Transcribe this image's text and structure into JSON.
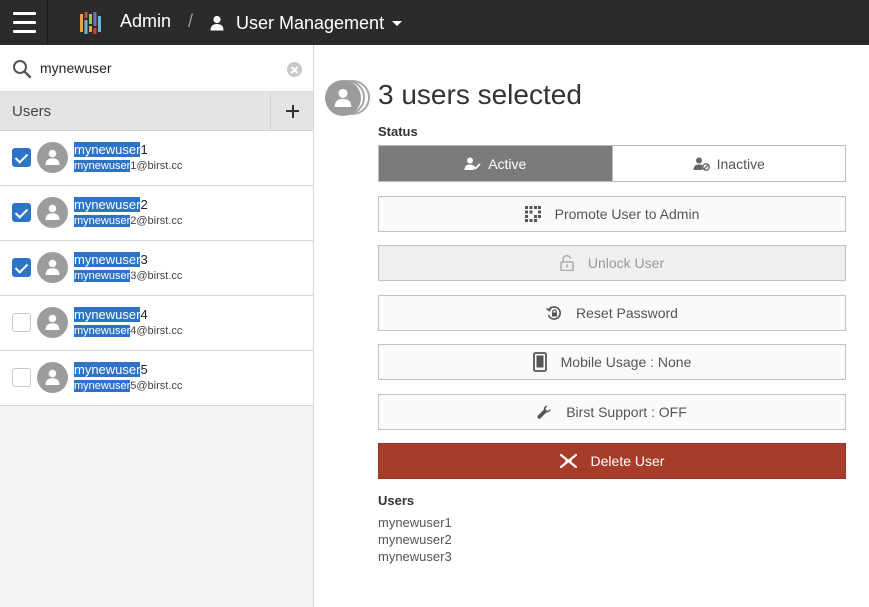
{
  "header": {
    "app_title": "Admin",
    "separator": "/",
    "breadcrumb_label": "User Management"
  },
  "search": {
    "value": "mynewuser",
    "placeholder": ""
  },
  "users_panel": {
    "header_label": "Users",
    "users": [
      {
        "name_highlight": "mynewuser",
        "name_rest": "1",
        "email_highlight": "mynewuser",
        "email_rest": "1@birst.cc",
        "checked": true
      },
      {
        "name_highlight": "mynewuser",
        "name_rest": "2",
        "email_highlight": "mynewuser",
        "email_rest": "2@birst.cc",
        "checked": true
      },
      {
        "name_highlight": "mynewuser",
        "name_rest": "3",
        "email_highlight": "mynewuser",
        "email_rest": "3@birst.cc",
        "checked": true
      },
      {
        "name_highlight": "mynewuser",
        "name_rest": "4",
        "email_highlight": "mynewuser",
        "email_rest": "4@birst.cc",
        "checked": false
      },
      {
        "name_highlight": "mynewuser",
        "name_rest": "5",
        "email_highlight": "mynewuser",
        "email_rest": "5@birst.cc",
        "checked": false
      }
    ]
  },
  "detail": {
    "selection_title": "3 users selected",
    "status_label": "Status",
    "status_active": "Active",
    "status_inactive": "Inactive",
    "actions": {
      "promote": "Promote User to Admin",
      "unlock": "Unlock User",
      "reset_password": "Reset Password",
      "mobile_usage": "Mobile Usage : None",
      "birst_support": "Birst Support : OFF",
      "delete": "Delete User"
    },
    "users_label": "Users",
    "selected_users": [
      "mynewuser1",
      "mynewuser2",
      "mynewuser3"
    ]
  },
  "colors": {
    "topbar": "#2b2b2b",
    "highlight": "#2d74c7",
    "active_toggle": "#7a7a7a",
    "delete_button": "#a83c2a"
  },
  "icons": {
    "menu": "hamburger-icon",
    "logo": "birst-logo-icon",
    "breadcrumb": "user-icon",
    "search": "search-icon",
    "clear": "clear-icon",
    "add": "plus-icon",
    "promote": "grid-icon",
    "unlock": "unlock-icon",
    "reset": "reset-password-icon",
    "mobile": "mobile-icon",
    "support": "wrench-icon",
    "delete": "x-cross-icon"
  }
}
